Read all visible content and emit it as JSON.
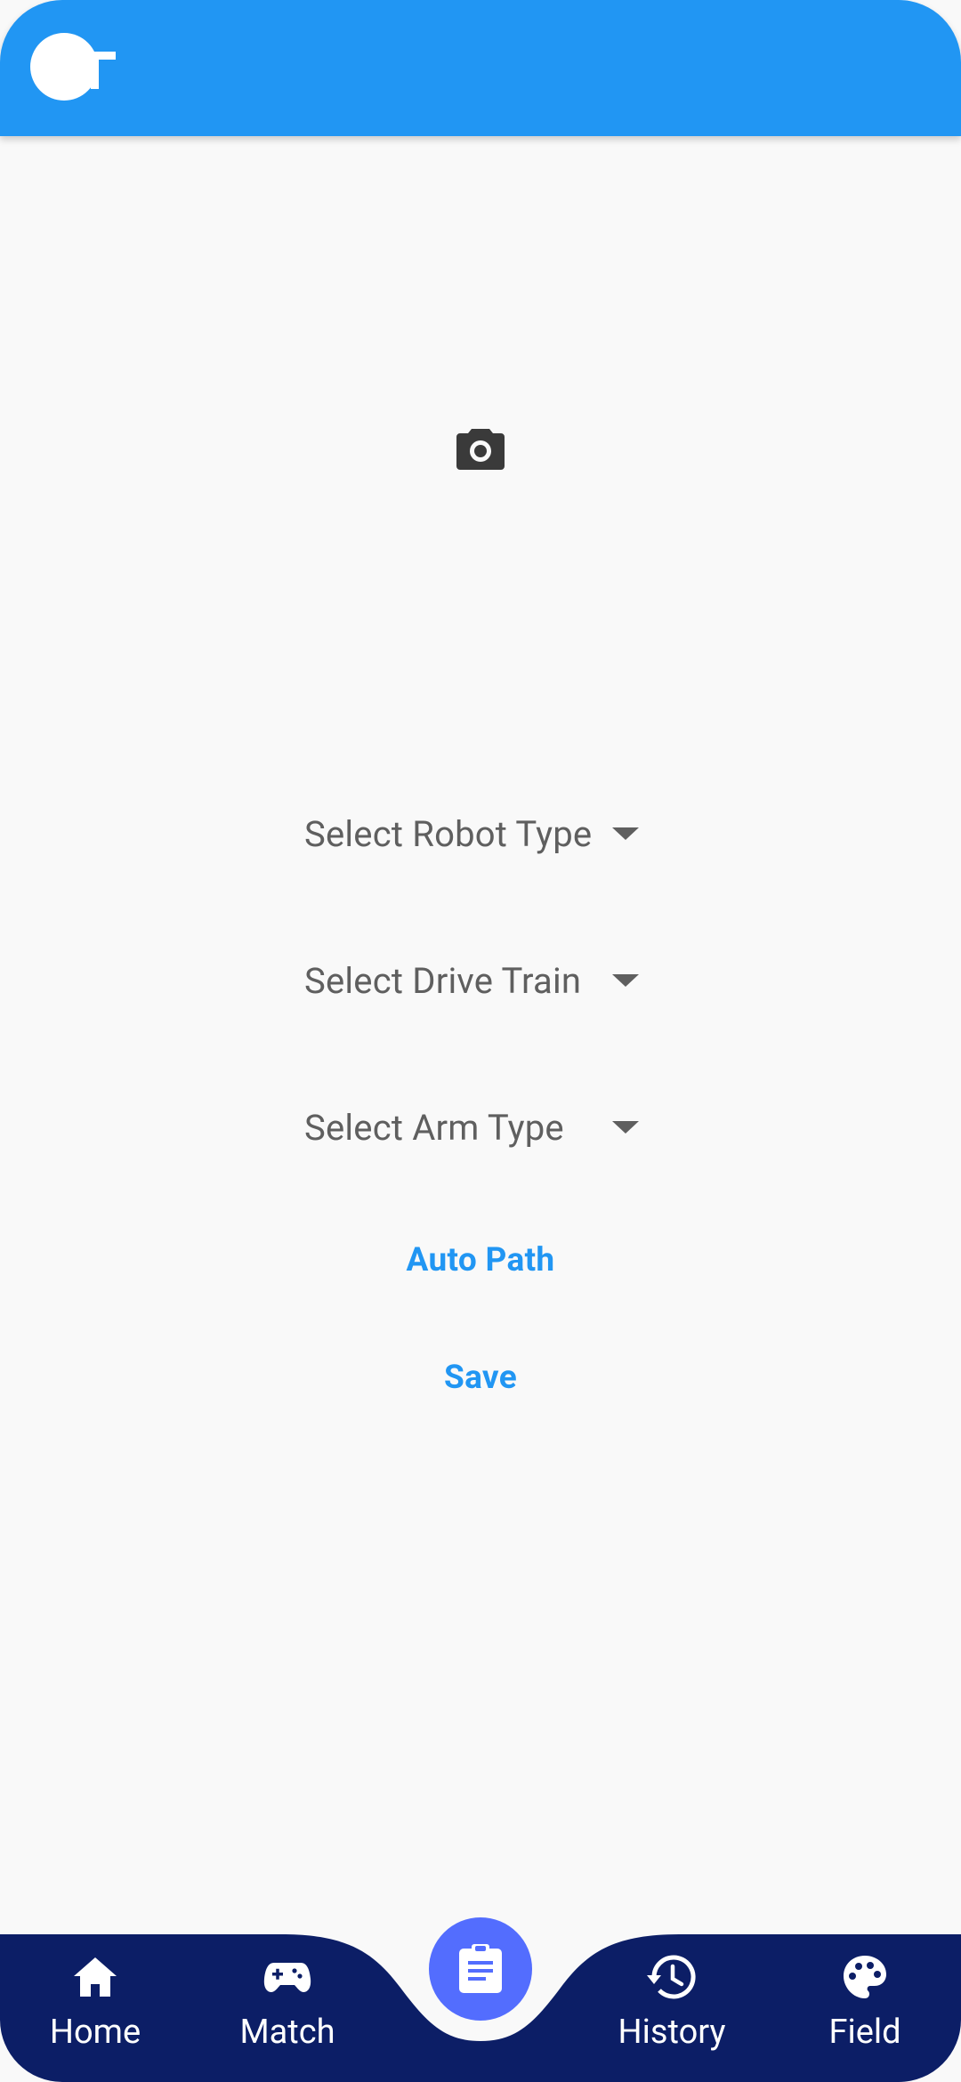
{
  "colors": {
    "app_bar": "#2196f3",
    "background": "#f9f9f9",
    "nav_bar": "#0c1e66",
    "fab": "#536dfe",
    "accent_text": "#2196f3",
    "dropdown_text": "#5f5f5f"
  },
  "header": {
    "logo_icon": "app-logo-icon"
  },
  "main": {
    "camera_icon": "camera-icon",
    "dropdowns": [
      {
        "label": "Select Robot Type",
        "icon": "arrow-drop-down-icon"
      },
      {
        "label": "Select Drive Train",
        "icon": "arrow-drop-down-icon"
      },
      {
        "label": "Select Arm Type",
        "icon": "arrow-drop-down-icon"
      }
    ],
    "auto_path_label": "Auto Path",
    "save_label": "Save"
  },
  "bottom_nav": {
    "items": [
      {
        "label": "Home",
        "icon": "home-icon"
      },
      {
        "label": "Match",
        "icon": "gamepad-icon"
      },
      {
        "label": "History",
        "icon": "history-icon"
      },
      {
        "label": "Field",
        "icon": "palette-icon"
      }
    ],
    "fab_icon": "clipboard-icon"
  }
}
